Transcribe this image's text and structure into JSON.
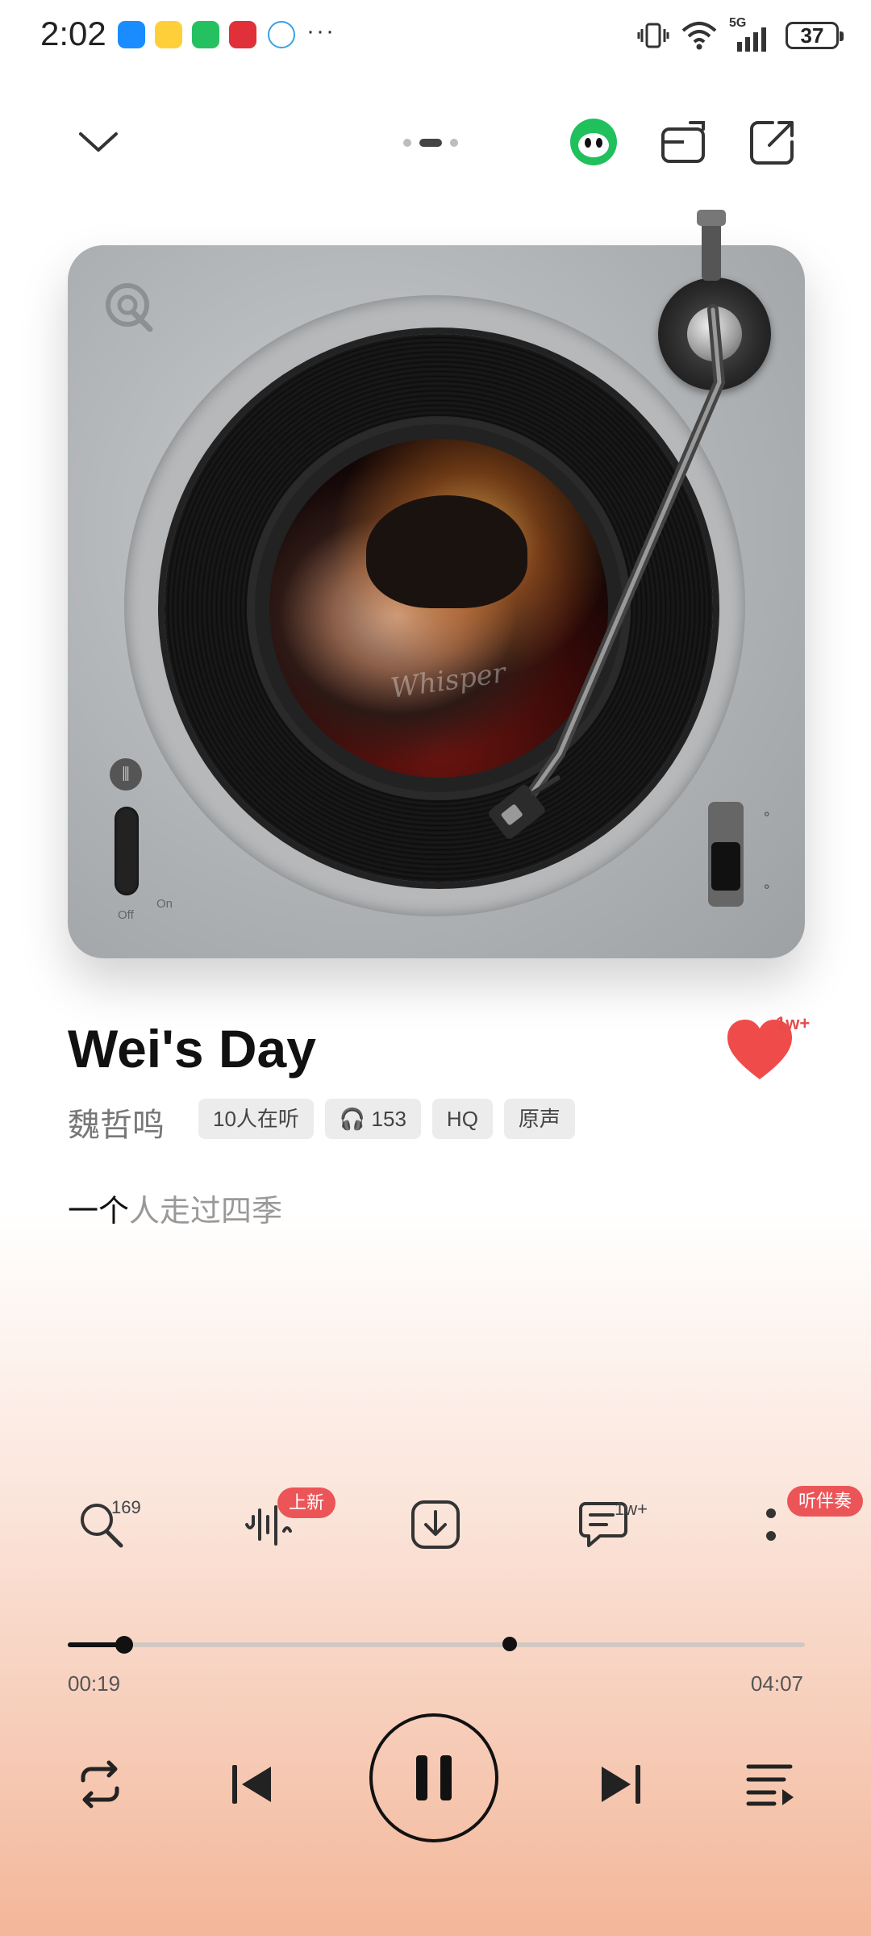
{
  "status": {
    "time": "2:02",
    "battery": "37",
    "overflow": "···",
    "network": "5G",
    "apps": [
      "contacts-app-icon",
      "weibo-icon",
      "wechat-icon",
      "news-app-icon",
      "browser-icon"
    ]
  },
  "topbar": {
    "pages": 3,
    "active_page": 2
  },
  "cover": {
    "script_text": "Whisper"
  },
  "song": {
    "title": "Wei's Day",
    "artist": "魏哲鸣",
    "like_count": "1w+",
    "badges": [
      "10人在听",
      "153",
      "HQ",
      "原声"
    ]
  },
  "lyric": {
    "sung": "一个",
    "rest": "人走过四季"
  },
  "turntable": {
    "off_label": "Off",
    "on_label": "On"
  },
  "actions": {
    "search_count": "169",
    "sound_effect_badge": "上新",
    "comments_count": "1w+",
    "accompaniment_badge": "听伴奏"
  },
  "progress": {
    "current": "00:19",
    "duration": "04:07",
    "fraction": 0.077,
    "marker_fraction": 0.6
  },
  "colors": {
    "accent_red": "#ec5558",
    "heart": "#ef4b4b",
    "wechat_green": "#20c05c"
  }
}
